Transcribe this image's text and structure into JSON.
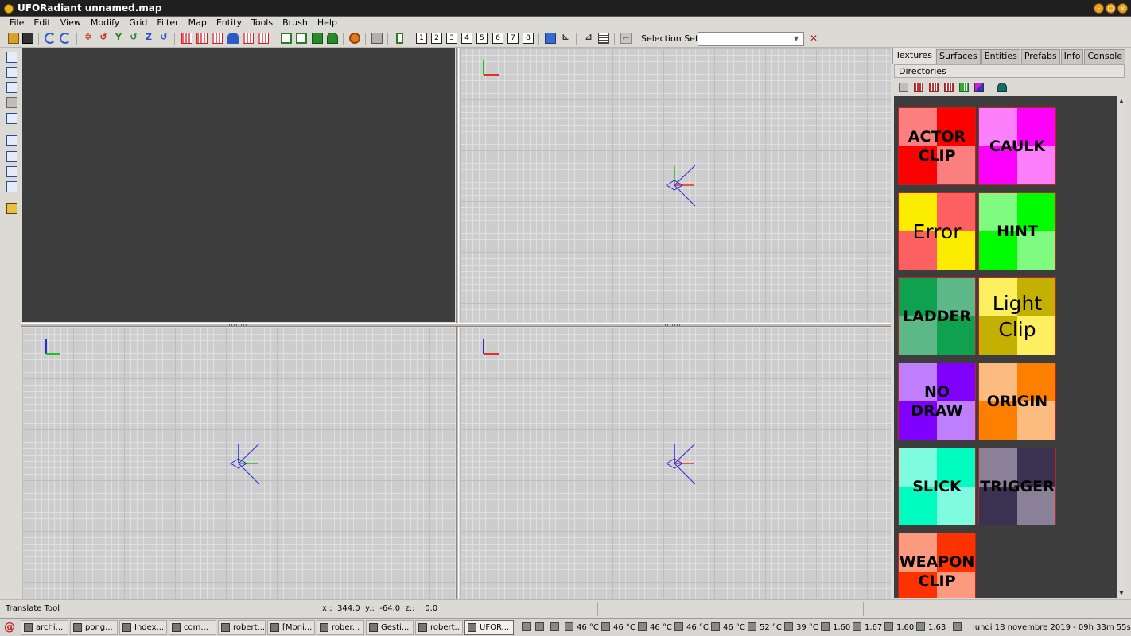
{
  "window": {
    "title": "UFORadiant unnamed.map"
  },
  "menu": [
    "File",
    "Edit",
    "View",
    "Modify",
    "Grid",
    "Filter",
    "Map",
    "Entity",
    "Tools",
    "Brush",
    "Help"
  ],
  "toolbar": {
    "selection_label": "Selection Set:",
    "selection_value": "",
    "view_buttons": [
      "1",
      "2",
      "3",
      "4",
      "5",
      "6",
      "7",
      "8"
    ]
  },
  "panel": {
    "tabs": [
      "Textures",
      "Surfaces",
      "Entities",
      "Prefabs",
      "Info",
      "Console"
    ],
    "active_tab": "Textures",
    "directories_label": "Directories",
    "textures": [
      {
        "label": "ACTOR\nCLIP",
        "colors": [
          "#fc7f7f",
          "#fc0000",
          "#fc0000",
          "#fc7f7f"
        ],
        "style": "bold"
      },
      {
        "label": "CAULK",
        "colors": [
          "#fc7ffc",
          "#fc00fc",
          "#fc00fc",
          "#fc7ffc"
        ],
        "style": "bold"
      },
      {
        "label": "Error",
        "colors": [
          "#fcec00",
          "#fc6060",
          "#fc6060",
          "#fcec00"
        ],
        "style": "big"
      },
      {
        "label": "HINT",
        "colors": [
          "#7ffc7f",
          "#00fc00",
          "#00fc00",
          "#7ffc7f"
        ],
        "style": "bold"
      },
      {
        "label": "LADDER",
        "colors": [
          "#0fa050",
          "#5cb887",
          "#5cb887",
          "#0fa050"
        ],
        "style": "bold"
      },
      {
        "label": "Light\nClip",
        "colors": [
          "#fcf060",
          "#c4b000",
          "#c4b000",
          "#fcf060"
        ],
        "style": "big"
      },
      {
        "label": "NO\nDRAW",
        "colors": [
          "#bf7ffc",
          "#7f00fc",
          "#7f00fc",
          "#bf7ffc"
        ],
        "style": "bold"
      },
      {
        "label": "ORIGIN",
        "colors": [
          "#fcbb7f",
          "#fc7f00",
          "#fc7f00",
          "#fcbb7f"
        ],
        "style": "bold"
      },
      {
        "label": "SLICK",
        "colors": [
          "#7ffce0",
          "#00fcc0",
          "#00fcc0",
          "#7ffce0"
        ],
        "style": "bold"
      },
      {
        "label": "TRIGGER",
        "colors": [
          "#8a8098",
          "#3a3250",
          "#3a3250",
          "#8a8098"
        ],
        "style": "bold"
      },
      {
        "label": "WEAPON\nCLIP",
        "colors": [
          "#fc9a7f",
          "#fc3300",
          "#fc3300",
          "#fc9a7f"
        ],
        "style": "bold"
      }
    ]
  },
  "status": {
    "tool": "Translate Tool",
    "coords": "x::  344.0  y::  -64.0  z::    0.0"
  },
  "taskbar": {
    "tasks": [
      "archi...",
      "pong...",
      "Index...",
      "com...",
      "robert...",
      "[Moni...",
      "rober...",
      "Gesti...",
      "robert...",
      "UFOR..."
    ],
    "active_task": "UFOR...",
    "tray": [
      "46 °C",
      "46 °C",
      "46 °C",
      "46 °C",
      "46 °C",
      "52 °C",
      "39 °C",
      "1,60",
      "1,67",
      "1,60",
      "1,63"
    ],
    "clock": "lundi 18 novembre 2019 - 09h 33m 55s"
  },
  "colors": {
    "axis_x": "#e03030",
    "axis_y": "#20c020",
    "axis_z": "#2a2ad8",
    "grid_bg": "#cdcdcd",
    "camera_bg": "#3d3d3d"
  }
}
